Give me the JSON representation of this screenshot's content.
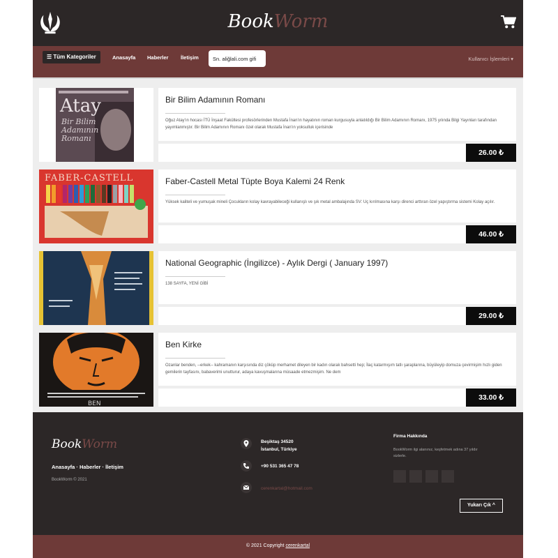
{
  "header": {
    "brand_part1": "Book",
    "brand_part2": "Worm"
  },
  "nav": {
    "categories_label": "☰ Tüm Kategoriler",
    "links": [
      "Anasayfa",
      "Haberler",
      "İletişim"
    ],
    "search_value": "Sn. aliğlali.com gifi",
    "user_menu": "Kullanıcı İşlemleri ▾"
  },
  "products": [
    {
      "title": "Bir Bilim Adamının Romanı",
      "description": "Oğuz Atay'ın hocası İTÜ İnşaat Fakültesi profesörlerinden Mustafa İnan'ın hayatının roman kurgusuyla anlatıldığı Bir Bilim Adamının Romanı, 1975 yılında Bilgi Yayınları tarafından yayımlanmıştır. Bir Bilim Adamının Romanı özel olarak Mustafa İnan'ın yoksulluk içerisinde",
      "price": "26.00 ₺",
      "image_text": "Atay"
    },
    {
      "title": "Faber-Castell Metal Tüpte Boya Kalemi 24 Renk",
      "description": "Yüksek kaliteli ve yumuşak mineli Çocukların kolay kavrayabileceği kullanışlı ve şık metal ambalajında SV: Uç kırılmasına karşı direnci arttıran özel yapıştırma sistemi Kolay açılır.",
      "price": "46.00 ₺",
      "image_text": "FABER-CASTELL"
    },
    {
      "title": "National Geographic (İngilizce) - Aylık Dergi ( January 1997)",
      "description": "138 SAYFA, YENİ GİBİ",
      "price": "29.00 ₺",
      "image_text": ""
    },
    {
      "title": "Ben Kirke",
      "description": "Ozanlar benden, --erkek-- kahramanın karşısında diz çöküp merhamet dileyen bir kadın olarak bahsetti hep; İlaç katarmışım tatlı şaraplarına, büyüleyip domuza çevirmişim hızlı giden gemilerin tayfasını, babaverimi unutturur, adaya kavuşmalarına müsaade etmezmişim. Ne dem",
      "price": "33.00 ₺",
      "image_text": "BEN"
    }
  ],
  "footer": {
    "brand_part1": "Book",
    "brand_part2": "Worm",
    "links": "Anasayfa · Haberler · İletişim",
    "copyright_small": "BookWorm © 2021",
    "address_line1": "Beşiktaş 34520",
    "address_line2": "İstanbul, Türkiye",
    "phone": "+90 531 365 47 78",
    "email": "cerenkartal@hotmail.com",
    "about_title": "Firma Hakkında",
    "about_text": "BookWorm ilgi alanınız, keşfetmek adına 37 yıldır sizlerle.",
    "up_button": "Yukarı Çık ^"
  },
  "bottom": {
    "copyright_prefix": "© 2021 Copyright",
    "copyright_name": "cerenkartal"
  },
  "colors": {
    "dark": "#2c2727",
    "maroon": "#6e3a38",
    "accent": "#7a4a48"
  }
}
